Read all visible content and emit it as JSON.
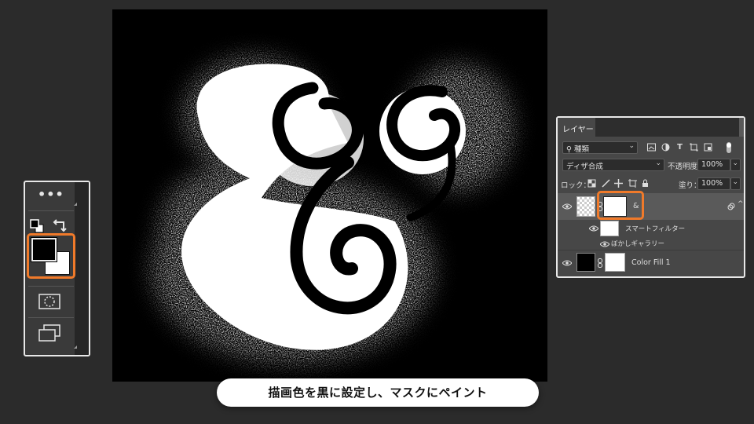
{
  "caption": "描画色を黒に設定し、マスクにペイント",
  "canvas": {
    "glyph": "&",
    "background": "#000000",
    "ink": "#ffffff"
  },
  "toolbar": {
    "more_icon": "•••",
    "swap_icon": "swap-arrows-icon",
    "reset_icon": "default-colors-icon",
    "foreground_color": "#000000",
    "background_color": "#ffffff",
    "quick_mask_icon": "quick-mask-icon",
    "screen_mode_icon": "screen-mode-icon",
    "highlight_color": "#f07a2a"
  },
  "layers_panel": {
    "tab_label": "レイヤー",
    "filter": {
      "icon": "search-icon",
      "value": "種類"
    },
    "blend_mode": "ディザ合成",
    "opacity_label": "不透明度：",
    "opacity_value": "100%",
    "lock_label": "ロック：",
    "fill_label": "塗り：",
    "fill_value": "100%",
    "layers": [
      {
        "name": "&",
        "type": "smart-object",
        "has_mask": true,
        "selected": true
      },
      {
        "name": "スマートフィルター",
        "type": "smart-filter-header"
      },
      {
        "name": "ぼかしギャラリー",
        "type": "smart-filter"
      },
      {
        "name": "Color Fill 1",
        "type": "fill",
        "has_mask": true
      }
    ]
  }
}
